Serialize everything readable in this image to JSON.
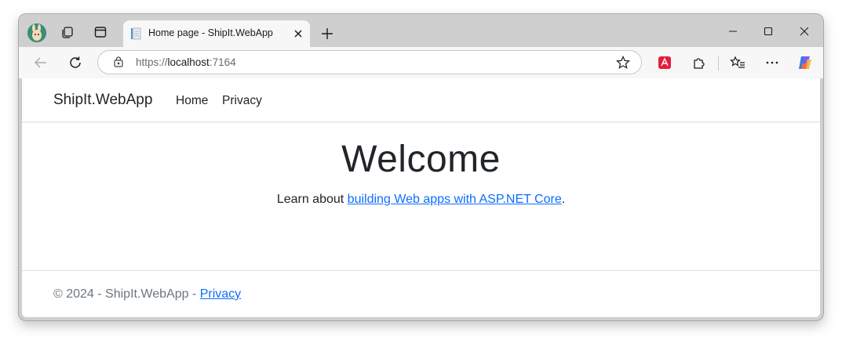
{
  "browser": {
    "tab": {
      "title": "Home page - ShipIt.WebApp"
    },
    "address": {
      "protocol": "https://",
      "host": "localhost",
      "port": ":7164"
    },
    "icons": {
      "profile": "profile-avatar-icon",
      "workspaces": "workspaces-icon",
      "tab_actions": "vertical-tabs-icon",
      "favicon": "document-favicon-icon",
      "close": "close-icon",
      "new_tab": "plus-icon",
      "minimize": "minimize-icon",
      "maximize": "maximize-icon",
      "window_close": "window-close-icon",
      "back": "back-arrow-icon",
      "refresh": "refresh-icon",
      "site_info": "site-info-icon",
      "favorite": "star-icon",
      "acrobat": "acrobat-extension-icon",
      "extensions": "extensions-puzzle-icon",
      "favorites": "favorites-list-icon",
      "more": "more-dots-icon",
      "copilot": "copilot-icon"
    },
    "colors": {
      "acrobat": "#e31d3b",
      "chrome_bg": "#cfcfcf",
      "toolbar_bg": "#f7f7f7"
    }
  },
  "page": {
    "navbar": {
      "brand": "ShipIt.WebApp",
      "links": [
        "Home",
        "Privacy"
      ]
    },
    "main": {
      "heading": "Welcome",
      "lead_prefix": "Learn about ",
      "lead_link": "building Web apps with ASP.NET Core",
      "lead_suffix": "."
    },
    "footer": {
      "text": "© 2024 - ShipIt.WebApp - ",
      "link": "Privacy"
    },
    "colors": {
      "link": "#0d6efd",
      "text": "#212529",
      "muted": "#6c757d"
    }
  }
}
